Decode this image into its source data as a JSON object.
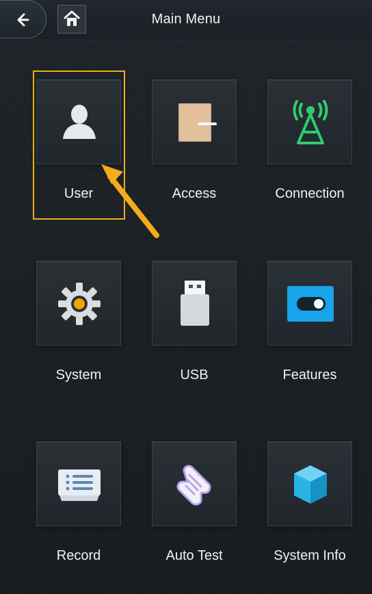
{
  "header": {
    "title": "Main Menu"
  },
  "nav": {
    "back_icon": "arrow-left-icon",
    "home_icon": "home-icon"
  },
  "colors": {
    "accent": "#f3ad1a",
    "connection": "#2ecc71",
    "system_gear_center": "#f2a400",
    "features_blue": "#18a4ea",
    "box_blue": "#28b6e8"
  },
  "menu": {
    "items": [
      {
        "label": "User",
        "icon": "user-icon"
      },
      {
        "label": "Access",
        "icon": "door-icon"
      },
      {
        "label": "Connection",
        "icon": "tower-icon"
      },
      {
        "label": "System",
        "icon": "gear-icon"
      },
      {
        "label": "USB",
        "icon": "usb-icon"
      },
      {
        "label": "Features",
        "icon": "toggle-icon"
      },
      {
        "label": "Record",
        "icon": "list-icon"
      },
      {
        "label": "Auto Test",
        "icon": "test-icon"
      },
      {
        "label": "System Info",
        "icon": "cube-icon"
      }
    ]
  }
}
